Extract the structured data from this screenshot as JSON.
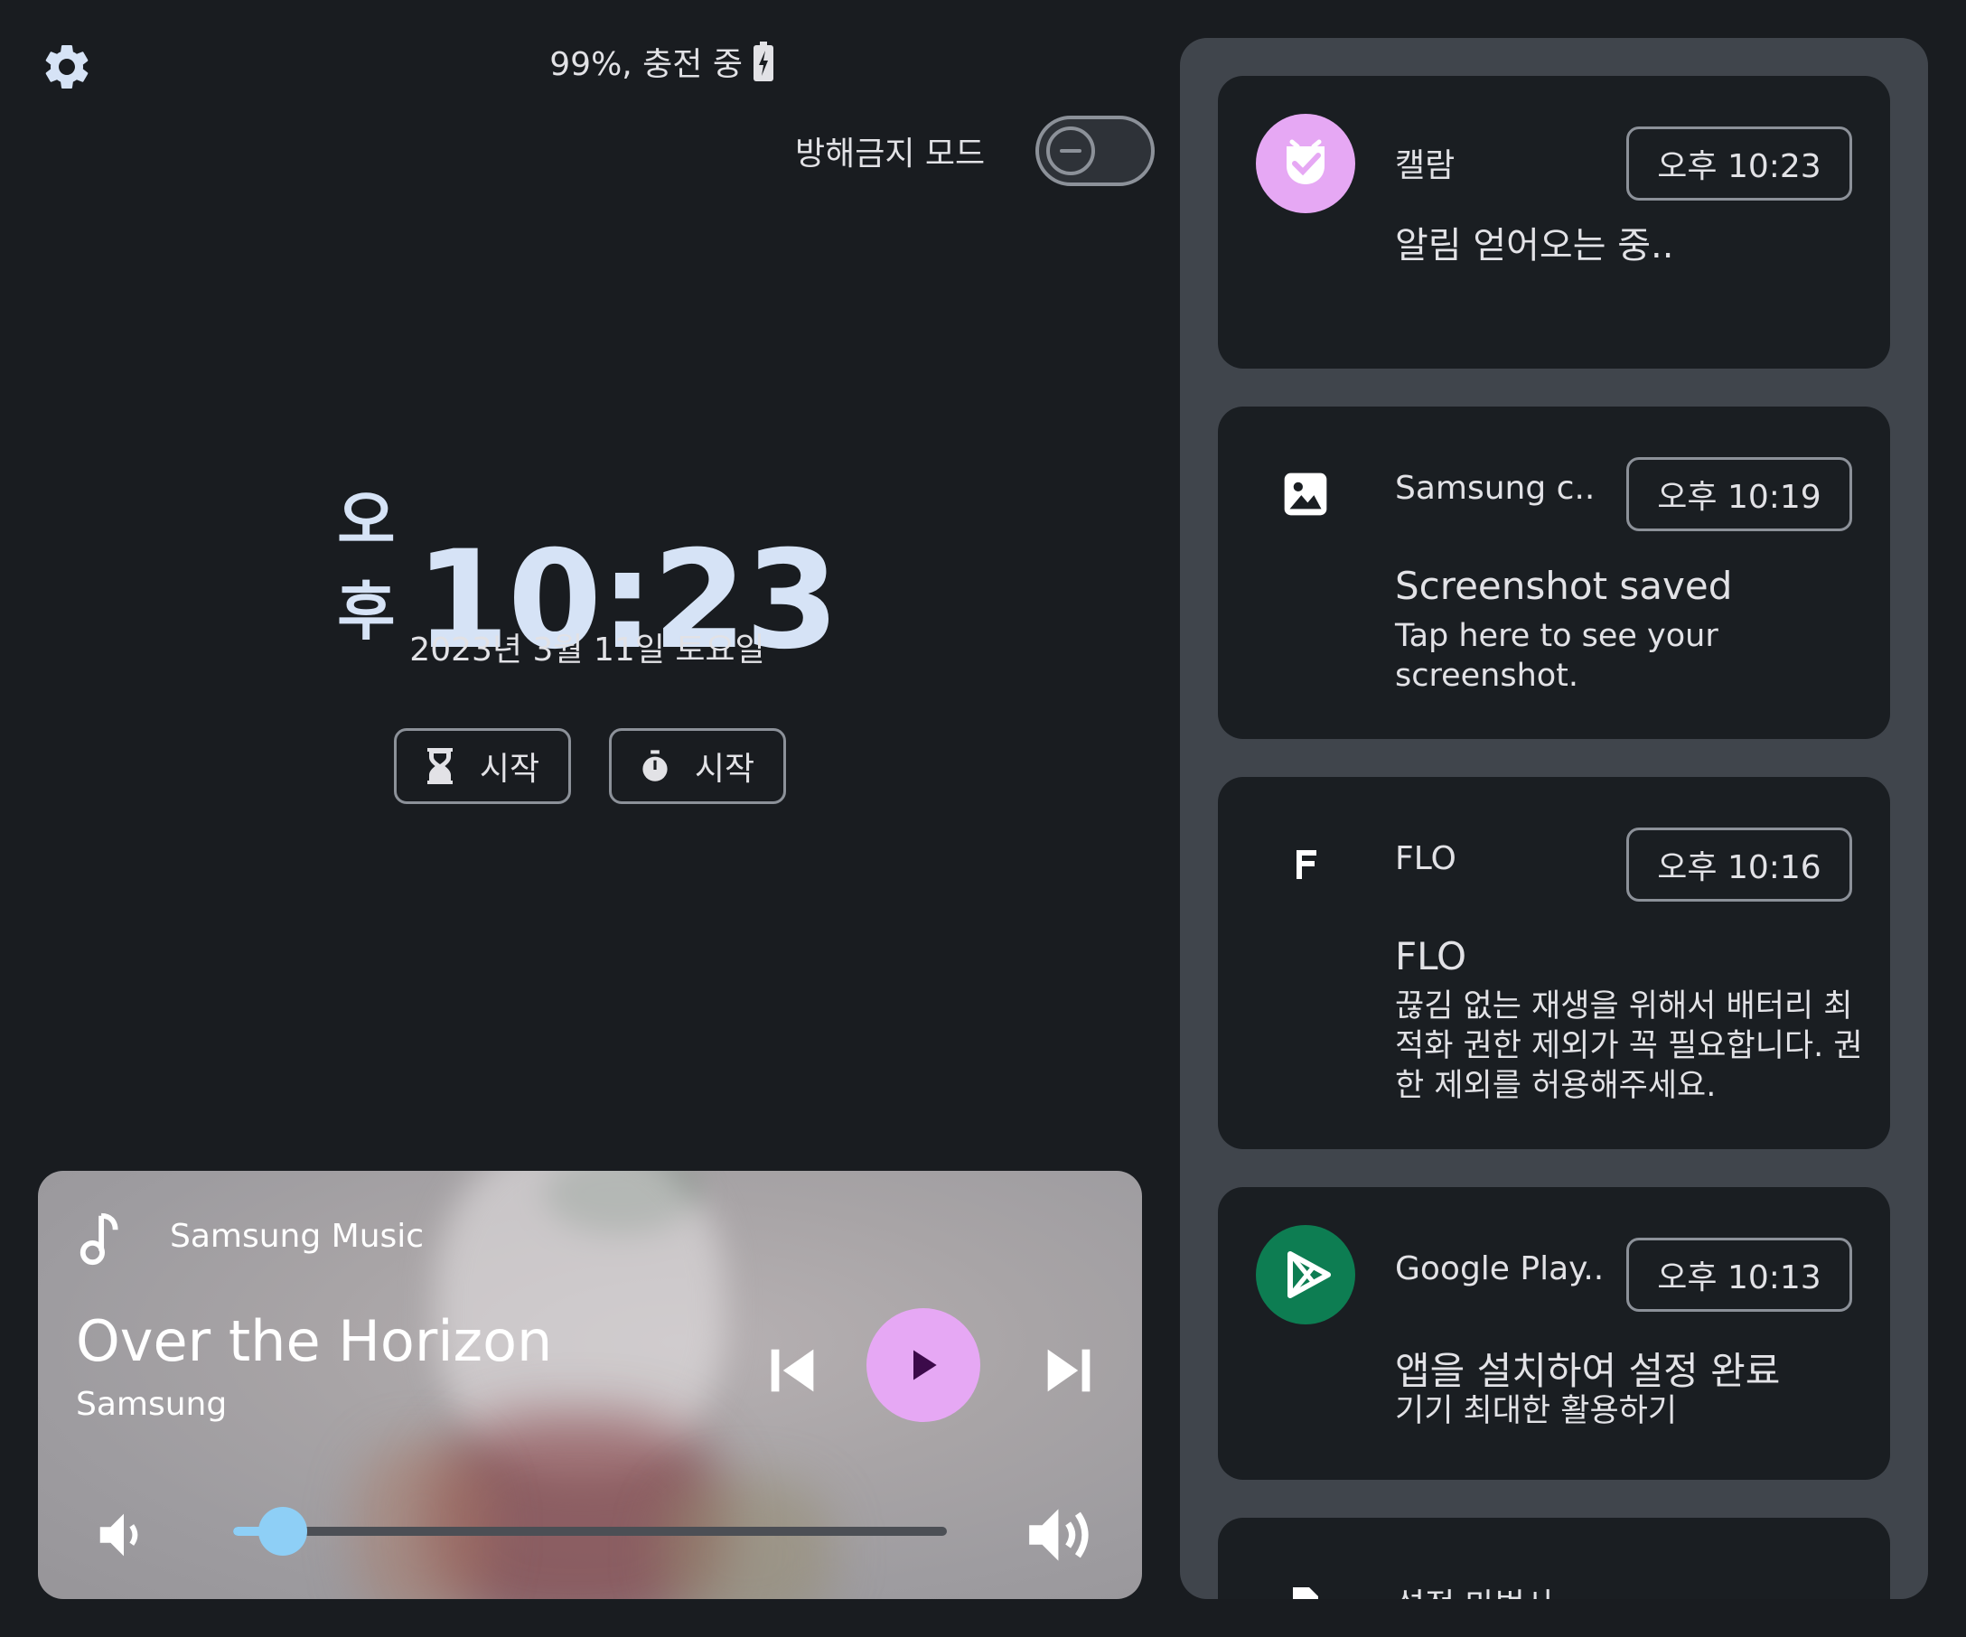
{
  "status": {
    "battery_text": "99%, 충전 중",
    "dnd_label": "방해금지 모드",
    "dnd_enabled": false
  },
  "clock": {
    "ampm": "오후",
    "time": "10:23",
    "date": "2023년 3월 11일 토요일"
  },
  "actions": {
    "timer_label": "시작",
    "stopwatch_label": "시작"
  },
  "media": {
    "app_name": "Samsung Music",
    "title": "Over the Horizon",
    "artist": "Samsung",
    "volume_fraction": 0.07,
    "play_color": "#e6a8f4"
  },
  "notifications": [
    {
      "icon": "calarm-icon",
      "icon_bg": "#e6a8f4",
      "app": "캘람",
      "time": "오후 10:23",
      "title": "",
      "body": "알림 얻어오는 중.."
    },
    {
      "icon": "image-icon",
      "icon_bg": "",
      "app": "Samsung c..",
      "time": "오후 10:19",
      "title": "Screenshot saved",
      "body": "Tap here to see your screenshot."
    },
    {
      "icon": "flo-icon",
      "icon_bg": "",
      "app": "FLO",
      "time": "오후 10:16",
      "title": "FLO",
      "body": "끊김 없는 재생을 위해서 배터리 최적화 권한 제외가 꼭 필요합니다. 권한 제외를 허용해주세요."
    },
    {
      "icon": "google-play-icon",
      "icon_bg": "#0d7d52",
      "app": "Google Play..",
      "time": "오후 10:13",
      "title": "앱을 설치하여 설정 완료",
      "body": "기기 최대한 활용하기"
    },
    {
      "icon": "file-icon",
      "icon_bg": "",
      "app": "설정 마법사",
      "time": "",
      "title": "",
      "body": ""
    }
  ]
}
